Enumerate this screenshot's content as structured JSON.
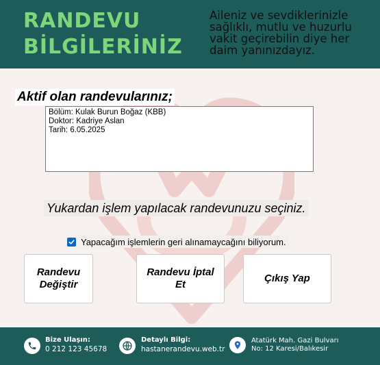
{
  "header": {
    "title": "RANDEVU\nBİLGİLERİNİZ",
    "slogan": "Aileniz ve sevdiklerinizle sağlıklı, mutlu ve huzurlu vakit geçirebilin diye her daim yanınızdayız."
  },
  "active_section": {
    "title": "Aktif olan randevularınız;",
    "appointment_lines": [
      "Bölüm: Kulak Burun Boğaz (KBB)",
      "Doktor: Kadriye Aslan",
      "Tarih: 6.05.2025"
    ]
  },
  "instruction": "Yukardan işlem yapılacak randevunuzu seçiniz.",
  "consent": {
    "label": "Yapacağım işlemlerin geri alınamaycağını biliyorum.",
    "checked": true
  },
  "buttons": {
    "change": "Randevu\nDeğiştir",
    "cancel": "Randevu İptal\nEt",
    "exit": "Çıkış Yap"
  },
  "footer": {
    "contact_label": "Bize Ulaşın:",
    "contact_value": "0 212 123 45678",
    "info_label": "Detaylı Bilgi:",
    "info_value": "hastanerandevu.web.tr",
    "address_lines": [
      "Atatürk Mah. Gazi Bulvarı",
      "No: 12 Karesi/Balıkesir"
    ]
  },
  "colors": {
    "header_bg": "#1e5c5a",
    "title_green": "#7ed67a",
    "checkbox_blue": "#0a67c4",
    "watermark_red": "#e8b3b3"
  },
  "icons": {
    "contact": "phone-icon",
    "info": "globe-icon",
    "address": "location-pin-icon",
    "watermark": "heart-stethoscope-icon"
  }
}
